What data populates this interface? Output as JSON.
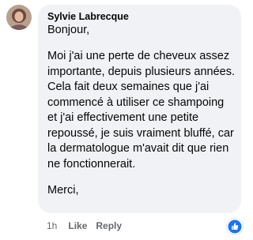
{
  "comment": {
    "author": "Sylvie Labrecque",
    "greeting": "Bonjour,",
    "body": "Moi j'ai une perte de cheveux assez importante, depuis plusieurs années. Cela fait deux semaines que j'ai commencé à utiliser ce shampoing et j'ai effectivement une petite repoussé, je suis vraiment bluffé, car la dermatologue m'avait dit que rien ne fonctionnerait.",
    "closing": "Merci,"
  },
  "actions": {
    "time": "1h",
    "like_label": "Like",
    "reply_label": "Reply"
  },
  "reaction": {
    "icon": "like-icon",
    "color": "#1877f2"
  },
  "colors": {
    "bubble": "#f0f2f5",
    "secondary_text": "#65676b"
  }
}
